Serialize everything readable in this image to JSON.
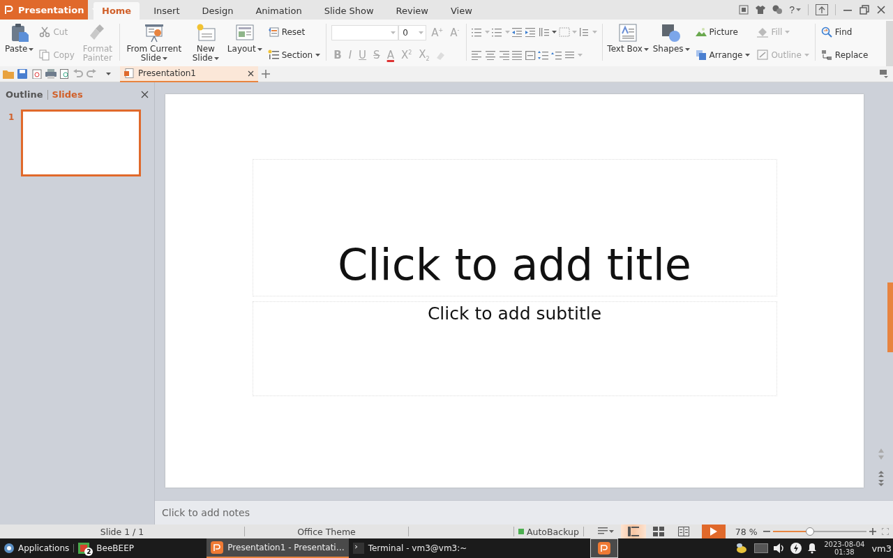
{
  "title_bar": {
    "app_menu": "Presentation",
    "help": "?"
  },
  "menu_tabs": [
    {
      "label": "Home",
      "selected": true
    },
    {
      "label": "Insert",
      "selected": false
    },
    {
      "label": "Design",
      "selected": false
    },
    {
      "label": "Animation",
      "selected": false
    },
    {
      "label": "Slide Show",
      "selected": false
    },
    {
      "label": "Review",
      "selected": false
    },
    {
      "label": "View",
      "selected": false
    }
  ],
  "ribbon": [
    {
      "kind": "large",
      "label": "Paste",
      "dropdown": true,
      "disabled": false
    },
    {
      "kind": "stack",
      "items": [
        {
          "label": "Cut",
          "dropdown": false,
          "disabled": true
        },
        {
          "label": "Copy",
          "dropdown": false,
          "disabled": true
        }
      ]
    },
    {
      "kind": "large",
      "label": "Format Painter",
      "dropdown": false,
      "disabled": true
    },
    {
      "kind": "separator"
    },
    {
      "kind": "large",
      "label": "From Current Slide",
      "dropdown": true,
      "disabled": false
    },
    {
      "kind": "large",
      "label": "New Slide",
      "dropdown": true,
      "disabled": false
    },
    {
      "kind": "large",
      "label": "Layout",
      "dropdown": true,
      "disabled": false
    },
    {
      "kind": "stack",
      "items": [
        {
          "label": "Reset",
          "dropdown": false,
          "disabled": false
        },
        {
          "label": "Section",
          "dropdown": true,
          "disabled": false
        }
      ]
    },
    {
      "kind": "separator"
    },
    {
      "kind": "font",
      "size": "0",
      "size_buttons": [
        {
          "label": "A$^{+}$",
          "disabled": true
        },
        {
          "label": "A$^{-}$",
          "disabled": true
        }
      ],
      "format_buttons": [
        {
          "label": "B",
          "disabled": true
        },
        {
          "label": "I",
          "disabled": true
        },
        {
          "label": "U",
          "disabled": true
        },
        {
          "label": "S",
          "disabled": true
        },
        {
          "label": "A",
          "disabled": true
        },
        {
          "label": "X$^{2}$",
          "disabled": true
        },
        {
          "label": "X$_{2}$",
          "disabled": true
        }
      ]
    },
    {
      "kind": "separator"
    },
    {
      "kind": "paragraph"
    },
    {
      "kind": "separator"
    },
    {
      "kind": "large",
      "label": "Text Box",
      "dropdown": true,
      "disabled": false
    },
    {
      "kind": "large",
      "label": "Shapes",
      "dropdown": true,
      "disabled": false
    },
    {
      "kind": "stack",
      "items": [
        {
          "label": "Picture",
          "dropdown": false,
          "disabled": false
        },
        {
          "label": "Arrange",
          "dropdown": true,
          "disabled": false
        }
      ]
    },
    {
      "kind": "stack",
      "items": [
        {
          "label": "Fill",
          "dropdown": true,
          "disabled": true
        },
        {
          "label": "Outline",
          "dropdown": true,
          "disabled": true
        }
      ]
    },
    {
      "kind": "separator"
    },
    {
      "kind": "stack",
      "items": [
        {
          "label": "Find",
          "dropdown": false,
          "disabled": false
        },
        {
          "label": "Replace",
          "dropdown": false,
          "disabled": false
        }
      ]
    }
  ],
  "doc_tabs": [
    {
      "label": "Presentation1",
      "selected": true
    }
  ],
  "slides_pane": {
    "tabs": [
      {
        "label": "Outline",
        "selected": false
      },
      {
        "label": "Slides",
        "selected": true
      }
    ],
    "thumbnails": [
      {
        "number": "1",
        "selected": true
      }
    ]
  },
  "slide": {
    "title": "Click to add title",
    "subtitle": "Click to add subtitle"
  },
  "notes": {
    "placeholder": "Click to add notes"
  },
  "status_bar": {
    "slide": "Slide 1 / 1",
    "theme": "Office Theme",
    "autobackup": {
      "label": "AutoBackup",
      "on": true
    },
    "views": [
      {
        "selected": true
      },
      {
        "selected": false
      },
      {
        "selected": false
      }
    ],
    "zoom": "78 %",
    "zoom_slider": {
      "level": 0.4
    }
  },
  "taskbar": {
    "start": "Applications",
    "windows": [
      {
        "label": "BeeBEEP",
        "badge": "2",
        "selected": false
      },
      {
        "label": "Presentation1 - Presentati…",
        "selected": true
      },
      {
        "label": "Terminal - vm3@vm3:~",
        "selected": false
      }
    ],
    "clock": {
      "date": "2023-08-04",
      "time": "01:38"
    },
    "user": "vm3"
  }
}
